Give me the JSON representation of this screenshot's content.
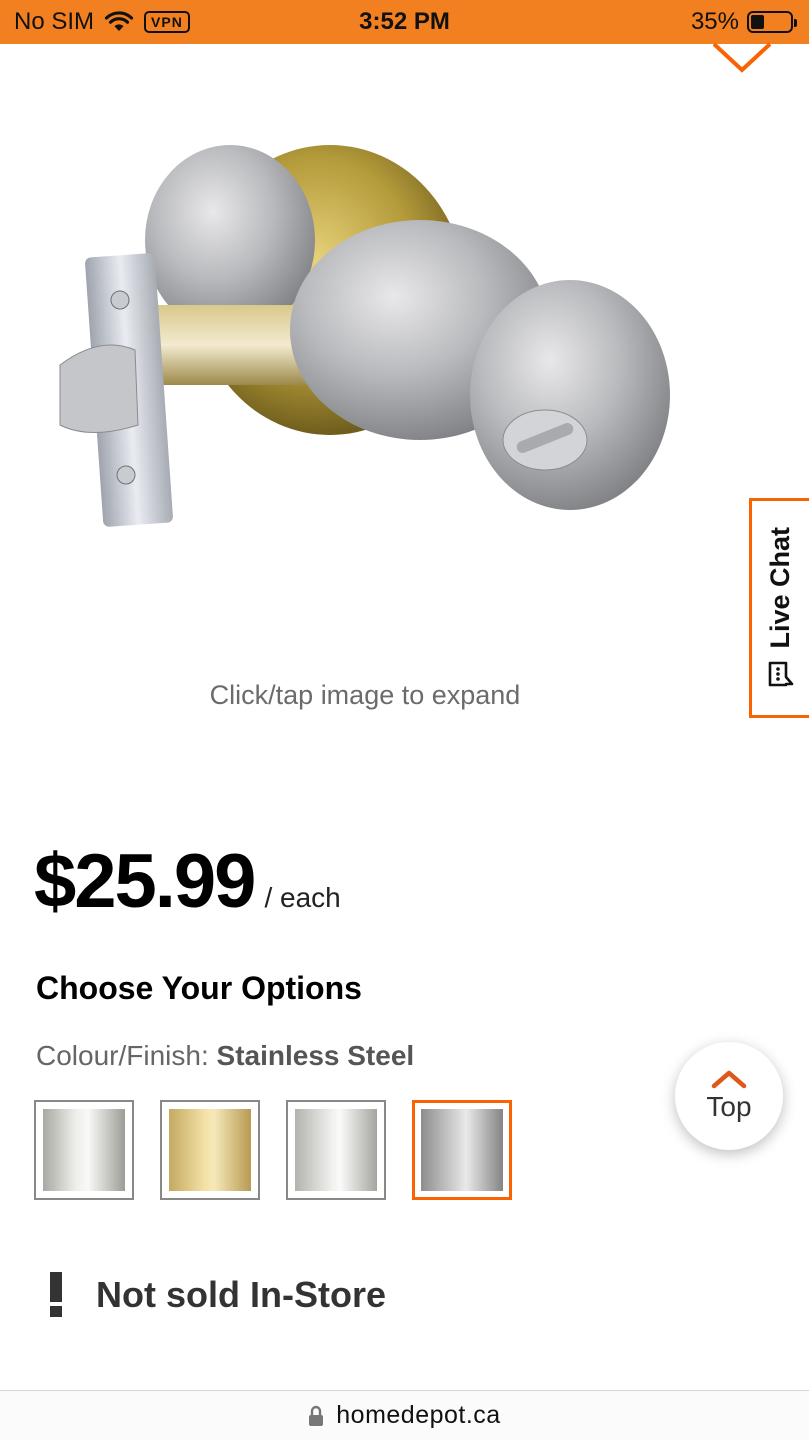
{
  "status_bar": {
    "carrier": "No SIM",
    "vpn": "VPN",
    "time": "3:52 PM",
    "battery_percent": "35%",
    "battery_level": 0.35,
    "background_color": "#f38020"
  },
  "gallery": {
    "hint": "Click/tap image to expand",
    "collapse_icon": "chevron-down-icon"
  },
  "live_chat": {
    "label": "Live Chat",
    "icon": "chat-bubble-icon",
    "accent_color": "#f96302"
  },
  "product": {
    "price": "$25.99",
    "price_unit": "/ each"
  },
  "options": {
    "heading": "Choose Your Options",
    "finish_label": "Colour/Finish:",
    "finish_value": "Stainless Steel",
    "swatches": [
      {
        "finish": "satin-nickel",
        "selected": false
      },
      {
        "finish": "polished-brass",
        "selected": false
      },
      {
        "finish": "polished-chrome",
        "selected": false
      },
      {
        "finish": "stainless-steel",
        "selected": true
      }
    ]
  },
  "scroll_top": {
    "label": "Top",
    "icon": "chevron-up-icon"
  },
  "availability": {
    "text": "Not sold In-Store",
    "icon": "exclamation-icon"
  },
  "browser": {
    "url": "homedepot.ca",
    "icon": "lock-icon"
  }
}
